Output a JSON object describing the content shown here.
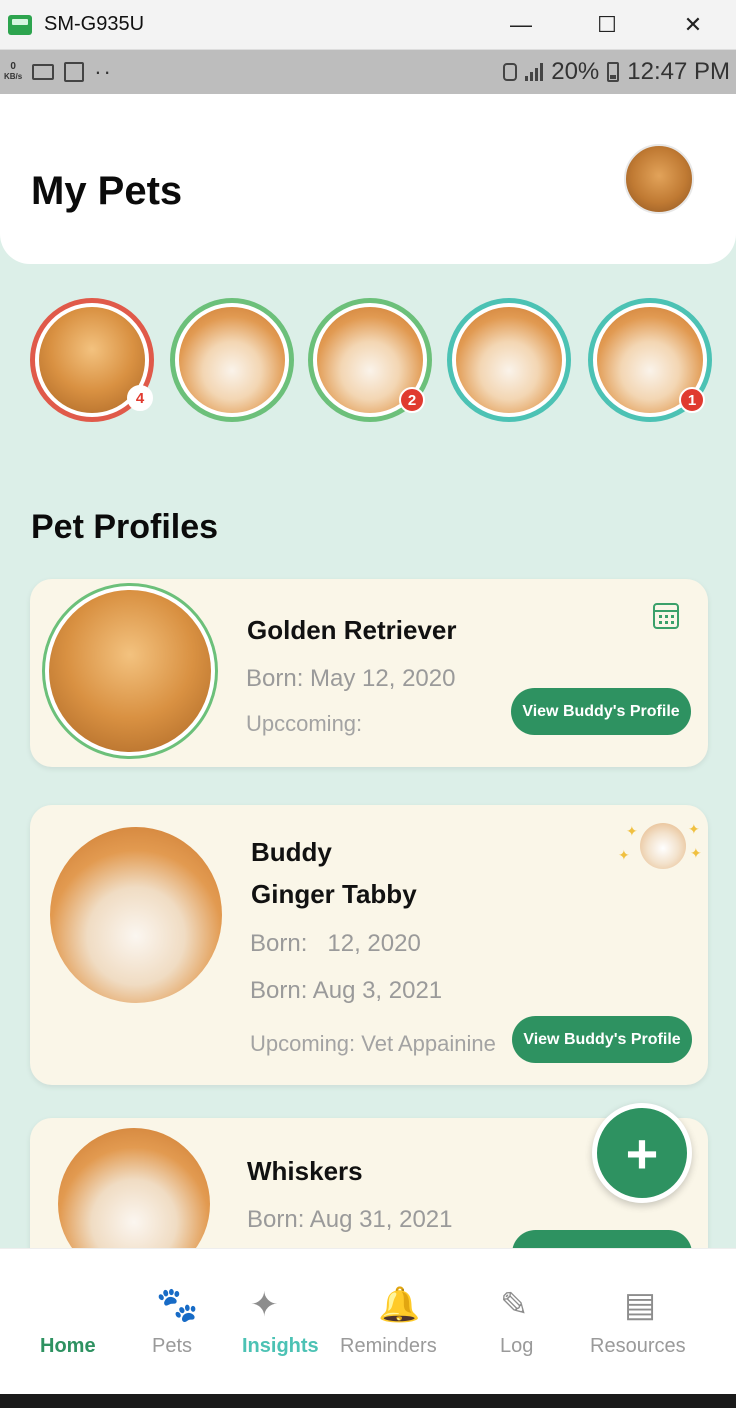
{
  "window": {
    "title": "SM-G935U",
    "minimize": "—",
    "maximize": "☐",
    "close": "✕"
  },
  "status_bar": {
    "kb": "0",
    "kb_unit": "KB/s",
    "dots": "··",
    "battery": "20%",
    "time": "12:47 PM"
  },
  "header": {
    "title": "My Pets"
  },
  "stories": [
    {
      "kind": "dog",
      "ring": "#e05a4a",
      "badge": "4"
    },
    {
      "kind": "cat",
      "ring": "#6cc07a",
      "badge": ""
    },
    {
      "kind": "cat",
      "ring": "#6cc07a",
      "badge": "2"
    },
    {
      "kind": "cat",
      "ring": "#4cc2b4",
      "badge": ""
    },
    {
      "kind": "cat",
      "ring": "#4cc2b4",
      "badge": "1"
    }
  ],
  "section": {
    "title": "Pet Profiles"
  },
  "cards": [
    {
      "name": "Golden Retriever",
      "born": "Born: May 12, 2020",
      "upcoming": "Upccoming:",
      "button": "View Buddy's Profile"
    },
    {
      "name": "Buddy",
      "breed": "Ginger Tabby",
      "born1": "Born:   12, 2020",
      "born2": "Born: Aug 3, 2021",
      "upcoming": "Upcoming: Vet Appainine",
      "button": "View Buddy's Profile"
    },
    {
      "name": "Whiskers",
      "born": "Born: Aug 31, 2021"
    }
  ],
  "fab": {
    "icon": "plus-icon",
    "label": "+"
  },
  "nav": [
    {
      "label": "Home",
      "icon": "",
      "state": "active"
    },
    {
      "label": "Pets",
      "icon": "paw-icon"
    },
    {
      "label": "Insights",
      "icon": "sparkles-icon",
      "state": "highlight"
    },
    {
      "label": "Reminders",
      "icon": "bell-icon"
    },
    {
      "label": "Log",
      "icon": "edit-list-icon"
    },
    {
      "label": "Resources",
      "icon": "documents-icon"
    }
  ],
  "colors": {
    "accent": "#2e9261",
    "teal": "#4cc2b4",
    "badge": "#e03a2f",
    "background": "#dcefe8",
    "card": "#faf6e8"
  }
}
